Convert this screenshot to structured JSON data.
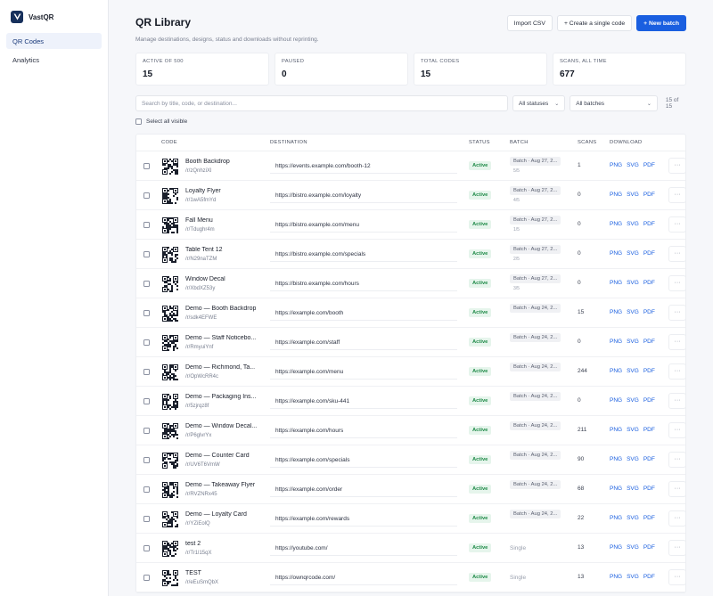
{
  "app": {
    "name": "VastQR"
  },
  "sidebar": {
    "items": [
      {
        "label": "QR Codes"
      },
      {
        "label": "Analytics"
      }
    ]
  },
  "header": {
    "title": "QR Library",
    "subtitle": "Manage destinations, designs, status and downloads without reprinting."
  },
  "actions": {
    "import_label": "Import CSV",
    "create_single_label": "+ Create a single code",
    "new_batch_label": "+ New batch"
  },
  "stats": [
    {
      "label": "ACTIVE OF 500",
      "value": "15"
    },
    {
      "label": "PAUSED",
      "value": "0"
    },
    {
      "label": "TOTAL CODES",
      "value": "15"
    },
    {
      "label": "SCANS, ALL TIME",
      "value": "677"
    }
  ],
  "filters": {
    "search_placeholder": "Search by title, code, or destination...",
    "status_value": "All statuses",
    "batch_value": "All batches",
    "count": "15 of 15",
    "select_all_label": "Select all visible"
  },
  "table": {
    "headers": {
      "code": "CODE",
      "destination": "DESTINATION",
      "status": "STATUS",
      "batch": "BATCH",
      "scans": "SCANS",
      "download": "DOWNLOAD"
    },
    "download_labels": {
      "png": "PNG",
      "svg": "SVG",
      "pdf": "PDF"
    },
    "more_label": "···",
    "rows": [
      {
        "title": "Booth Backdrop",
        "slug": "/r/zQnhziXl",
        "destination": "https://events.example.com/booth-12",
        "status": "Active",
        "batch": "Batch · Aug 27, 2...",
        "batch_sub": "5/5",
        "scans": "1"
      },
      {
        "title": "Loyalty Flyer",
        "slug": "/r/1wA5fmYd",
        "destination": "https://bistro.example.com/loyalty",
        "status": "Active",
        "batch": "Batch · Aug 27, 2...",
        "batch_sub": "4/5",
        "scans": "0"
      },
      {
        "title": "Fall Menu",
        "slug": "/r/Tdughr4m",
        "destination": "https://bistro.example.com/menu",
        "status": "Active",
        "batch": "Batch · Aug 27, 2...",
        "batch_sub": "1/5",
        "scans": "0"
      },
      {
        "title": "Table Tent 12",
        "slug": "/r/N29naTZM",
        "destination": "https://bistro.example.com/specials",
        "status": "Active",
        "batch": "Batch · Aug 27, 2...",
        "batch_sub": "2/5",
        "scans": "0"
      },
      {
        "title": "Window Decal",
        "slug": "/r/XbdXZ53y",
        "destination": "https://bistro.example.com/hours",
        "status": "Active",
        "batch": "Batch · Aug 27, 2...",
        "batch_sub": "3/5",
        "scans": "0"
      },
      {
        "title": "Demo — Booth Backdrop",
        "slug": "/r/sdk4EFWE",
        "destination": "https://example.com/booth",
        "status": "Active",
        "batch": "Batch · Aug 24, 2...",
        "batch_sub": "",
        "scans": "15"
      },
      {
        "title": "Demo — Staff Noticebo...",
        "slug": "/r/RmyuiYnf",
        "destination": "https://example.com/staff",
        "status": "Active",
        "batch": "Batch · Aug 24, 2...",
        "batch_sub": "",
        "scans": "0"
      },
      {
        "title": "Demo — Richmond, Ta...",
        "slug": "/r/OpWcRR4c",
        "destination": "https://example.com/menu",
        "status": "Active",
        "batch": "Batch · Aug 24, 2...",
        "batch_sub": "",
        "scans": "244"
      },
      {
        "title": "Demo — Packaging Ins...",
        "slug": "/r/5zjrqz8f",
        "destination": "https://example.com/sku-441",
        "status": "Active",
        "batch": "Batch · Aug 24, 2...",
        "batch_sub": "",
        "scans": "0"
      },
      {
        "title": "Demo — Window Decal...",
        "slug": "/r/P6glvrYx",
        "destination": "https://example.com/hours",
        "status": "Active",
        "batch": "Batch · Aug 24, 2...",
        "batch_sub": "",
        "scans": "211"
      },
      {
        "title": "Demo — Counter Card",
        "slug": "/r/UV6T6VmW",
        "destination": "https://example.com/specials",
        "status": "Active",
        "batch": "Batch · Aug 24, 2...",
        "batch_sub": "",
        "scans": "90"
      },
      {
        "title": "Demo — Takeaway Flyer",
        "slug": "/r/RVZNRx45",
        "destination": "https://example.com/order",
        "status": "Active",
        "batch": "Batch · Aug 24, 2...",
        "batch_sub": "",
        "scans": "68"
      },
      {
        "title": "Demo — Loyalty Card",
        "slug": "/r/YZiEolQ",
        "destination": "https://example.com/rewards",
        "status": "Active",
        "batch": "Batch · Aug 24, 2...",
        "batch_sub": "",
        "scans": "22"
      },
      {
        "title": "test 2",
        "slug": "/r/Tr1l15qX",
        "destination": "https://youtube.com/",
        "status": "Active",
        "batch": "Single",
        "batch_sub": "",
        "scans": "13"
      },
      {
        "title": "TEST",
        "slug": "/r/eEuSmQbX",
        "destination": "https://ownqrcode.com/",
        "status": "Active",
        "batch": "Single",
        "batch_sub": "",
        "scans": "13"
      }
    ]
  },
  "colors": {
    "accent": "#1a5fe0",
    "active_status": "#1e8a47",
    "logo": "#17305c"
  }
}
